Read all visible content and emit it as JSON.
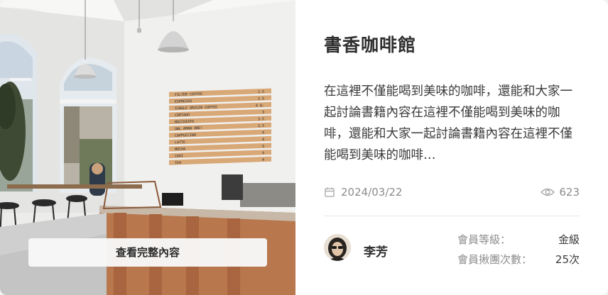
{
  "card": {
    "image_alt": "café interior photo",
    "view_button_label": "查看完整內容",
    "title": "書香咖啡館",
    "description": "在這裡不僅能喝到美味的咖啡，還能和大家一起討論書籍內容在這裡不僅能喝到美味的咖啡，還能和大家一起討論書籍內容在這裡不僅能喝到美味的咖啡…",
    "date": "2024/03/22",
    "date_icon": "calendar-icon",
    "views": "623",
    "views_icon": "eye-icon",
    "author": {
      "name": "李芳",
      "avatar_icon": "avatar"
    },
    "member_level_label": "會員等級：",
    "member_level_value": "金級",
    "member_visits_label": "會員揪團次數：",
    "member_visits_value": "25次"
  },
  "menu_board": {
    "items": [
      {
        "name": "FILTER COFFEE",
        "price": "2.5"
      },
      {
        "name": "ESPRESSO",
        "price": "2.5"
      },
      {
        "name": "SINGLE ORIGIN COFFEE",
        "price": "A Q."
      },
      {
        "name": "CORTADO",
        "price": "3"
      },
      {
        "name": "MACCHIATO",
        "price": "3.5"
      },
      {
        "name": "OWL AMAN ONE!",
        "price": "3.5"
      },
      {
        "name": "CAPPUCCINO",
        "price": "4"
      },
      {
        "name": "LATTE",
        "price": "4"
      },
      {
        "name": "MOCHA",
        "price": "5"
      },
      {
        "name": "CHAI",
        "price": "4"
      },
      {
        "name": "TEA",
        "price": "4"
      }
    ]
  }
}
